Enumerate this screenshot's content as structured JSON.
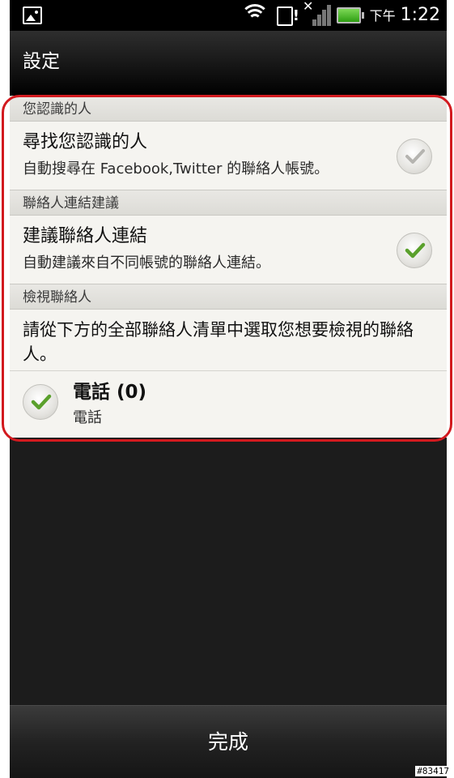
{
  "status_bar": {
    "ampm": "下午",
    "time": "1:22",
    "icons": [
      "gallery-icon",
      "wifi-icon",
      "sd-card-alert-icon",
      "no-signal-icon",
      "battery-icon"
    ]
  },
  "title_bar": {
    "title": "設定"
  },
  "sections": {
    "known_people": {
      "header": "您認識的人",
      "item_title": "尋找您認識的人",
      "item_desc": "自動搜尋在 Facebook,Twitter 的聯絡人帳號。",
      "checked": false
    },
    "link_suggest": {
      "header": "聯絡人連結建議",
      "item_title": "建議聯絡人連結",
      "item_desc": "自動建議來自不同帳號的聯絡人連結。",
      "checked": true
    },
    "view_contacts": {
      "header": "檢視聯絡人",
      "description": "請從下方的全部聯絡人清單中選取您想要檢視的聯絡人。",
      "account_title": "電話 (0)",
      "account_subtitle": "電話",
      "checked": true
    }
  },
  "done_button": {
    "label": "完成"
  },
  "watermark": "#83417",
  "colors": {
    "highlight": "#d21a1f",
    "check_green": "#5aa02c",
    "check_gray": "#b5b4b0"
  }
}
